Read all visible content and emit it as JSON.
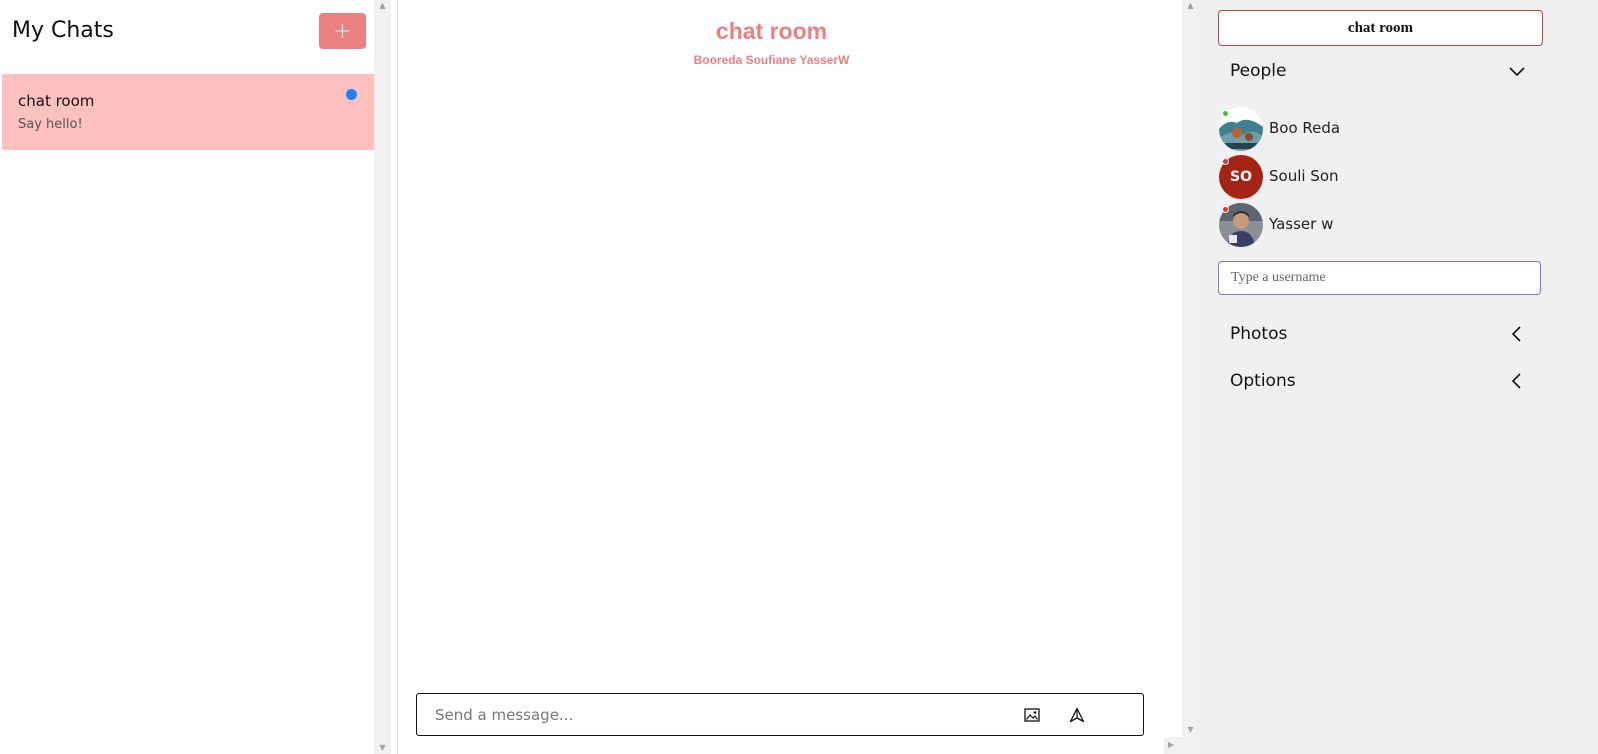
{
  "chat_list": {
    "title": "My Chats",
    "new_button_label": "+",
    "chats": [
      {
        "title": "chat room",
        "preview": "Say hello!",
        "unread": true
      }
    ]
  },
  "conversation": {
    "title": "chat room",
    "members_line": "Booreda Soufiane YasserW",
    "composer": {
      "placeholder": "Send a message..."
    }
  },
  "details": {
    "room_name": "chat room",
    "sections": {
      "people": "People",
      "photos": "Photos",
      "options": "Options"
    },
    "people": [
      {
        "name": "Boo Reda",
        "avatar": "photo",
        "status": "online"
      },
      {
        "name": "Souli Son",
        "avatar": "initials",
        "initials": "SO",
        "status": "offline"
      },
      {
        "name": "Yasser w",
        "avatar": "photo",
        "status": "offline"
      }
    ],
    "username_input": {
      "placeholder": "Type a username"
    }
  },
  "colors": {
    "accent": "#ec7f7f",
    "selected_chat": "#ffc0c0",
    "unread": "#1a82ff",
    "online": "#3cc13c",
    "offline": "#e0303a",
    "initials_avatar": "#a52414"
  }
}
